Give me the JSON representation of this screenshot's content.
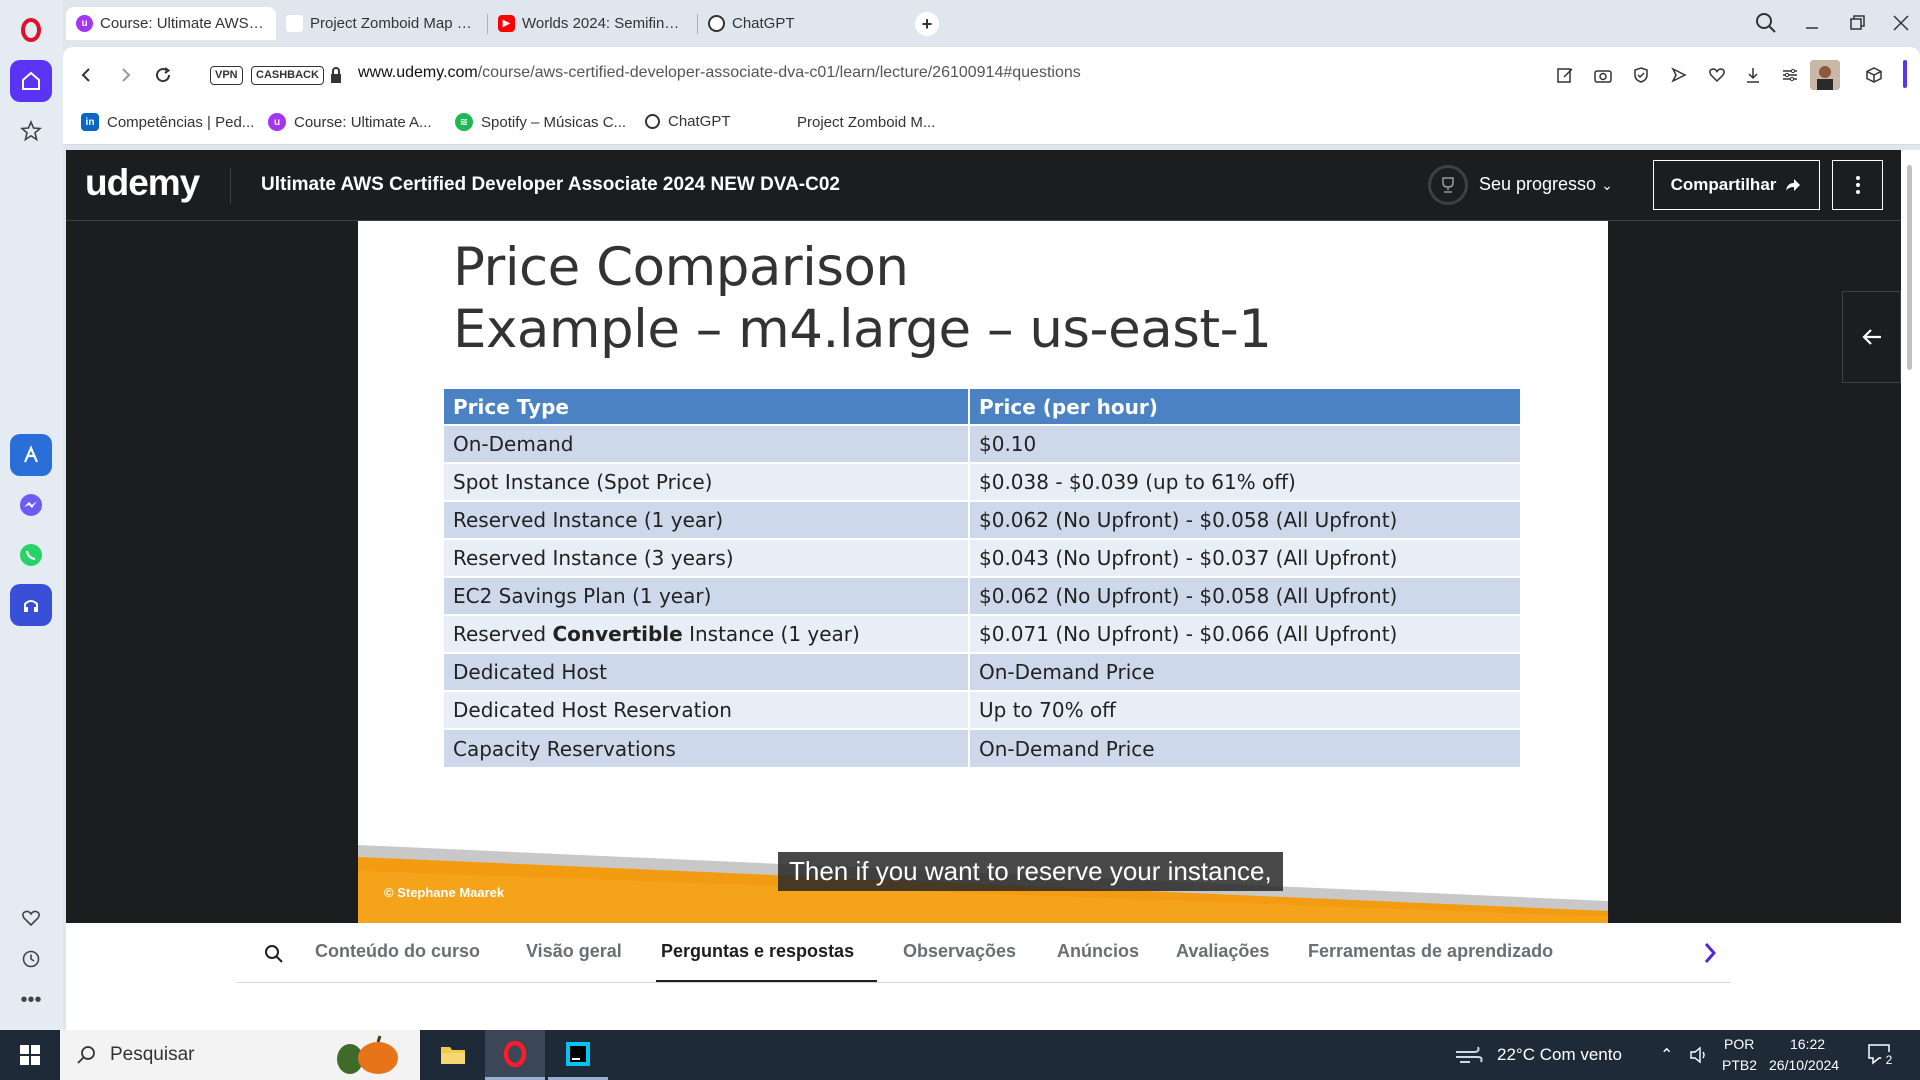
{
  "browser": {
    "tabs": [
      {
        "title": "Course: Ultimate AWS Cer",
        "favicon": "udemy-icon",
        "active": true
      },
      {
        "title": "Project Zomboid Map Pro",
        "favicon": "blank-page-icon",
        "active": false
      },
      {
        "title": "Worlds 2024: Semifinal (D",
        "favicon": "youtube-icon",
        "active": false
      },
      {
        "title": "ChatGPT",
        "favicon": "chatgpt-icon",
        "active": false
      }
    ],
    "vpn_label": "VPN",
    "cashback_label": "CASHBACK",
    "url_host": "www.udemy.com",
    "url_path": "/course/aws-certified-developer-associate-dva-c01/learn/lecture/26100914#questions",
    "bookmarks": [
      {
        "label": "Competências | Ped...",
        "icon": "linkedin-icon"
      },
      {
        "label": "Course: Ultimate A...",
        "icon": "udemy-icon"
      },
      {
        "label": "Spotify – Músicas C...",
        "icon": "spotify-icon"
      },
      {
        "label": "ChatGPT",
        "icon": "chatgpt-icon"
      },
      {
        "label": "Project Zomboid M...",
        "icon": "blank-page-icon"
      }
    ]
  },
  "udemy": {
    "logo": "udemy",
    "course_title": "Ultimate AWS Certified Developer Associate 2024 NEW DVA-C02",
    "progress_label": "Seu progresso",
    "share_label": "Compartilhar"
  },
  "slide": {
    "title_line1": "Price Comparison",
    "title_line2": "Example – m4.large – us-east-1",
    "table": {
      "headers": [
        "Price Type",
        "Price (per hour)"
      ],
      "rows": [
        {
          "type": "On-Demand",
          "price": "$0.10"
        },
        {
          "type": "Spot Instance (Spot Price)",
          "price": "$0.038 - $0.039 (up to 61% off)"
        },
        {
          "type": "Reserved Instance (1 year)",
          "price": "$0.062 (No Upfront) - $0.058 (All Upfront)"
        },
        {
          "type": "Reserved Instance (3 years)",
          "price": "$0.043 (No Upfront) - $0.037 (All Upfront)"
        },
        {
          "type": "EC2 Savings Plan (1 year)",
          "price": "$0.062 (No Upfront) - $0.058 (All Upfront)"
        },
        {
          "type_prefix": "Reserved ",
          "type_bold": "Convertible",
          "type_suffix": " Instance (1 year)",
          "price": "$0.071 (No Upfront) - $0.066 (All Upfront)"
        },
        {
          "type": "Dedicated Host",
          "price": "On-Demand Price"
        },
        {
          "type": "Dedicated Host Reservation",
          "price": "Up to 70% off"
        },
        {
          "type": "Capacity Reservations",
          "price": "On-Demand Price"
        }
      ]
    },
    "copyright": "© Stephane Maarek",
    "caption": "Then if you want to reserve your instance,",
    "header_color": "#4a82c4",
    "accent_color": "#f39c12"
  },
  "course_tabs": [
    {
      "label": "Conteúdo do curso",
      "active": false
    },
    {
      "label": "Visão geral",
      "active": false
    },
    {
      "label": "Perguntas e respostas",
      "active": true
    },
    {
      "label": "Observações",
      "active": false
    },
    {
      "label": "Anúncios",
      "active": false
    },
    {
      "label": "Avaliações",
      "active": false
    },
    {
      "label": "Ferramentas de aprendizado",
      "active": false
    }
  ],
  "taskbar": {
    "search_placeholder": "Pesquisar",
    "weather": "22°C  Com vento",
    "lang_top": "POR",
    "lang_bottom": "PTB2",
    "time": "16:22",
    "date": "26/10/2024",
    "notification_count": "2"
  }
}
